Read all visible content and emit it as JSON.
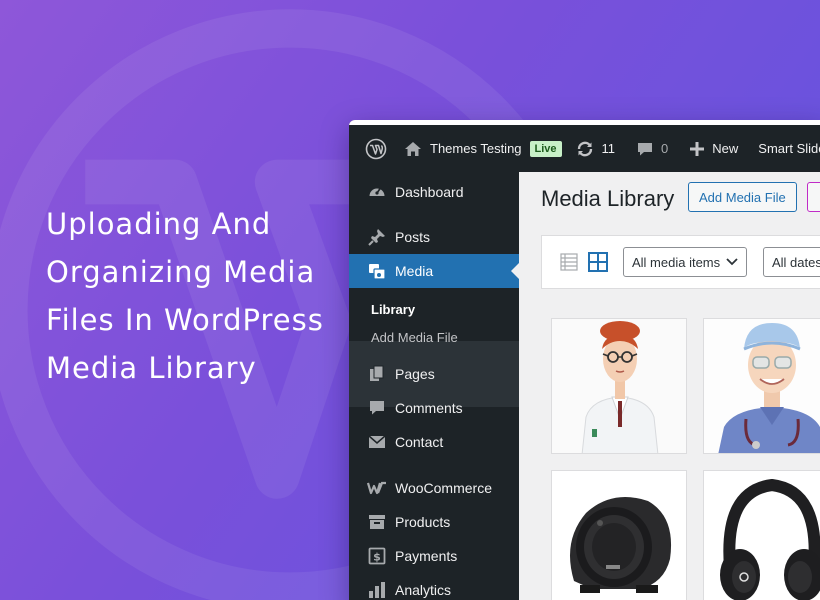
{
  "headline": {
    "lines": [
      "Uploading And",
      "Organizing Media",
      "Files In WordPress",
      "Media Library"
    ]
  },
  "colors": {
    "bg_from": "#8e57d9",
    "bg_to": "#5f55e0",
    "admin_dark": "#1d2327",
    "accent": "#2271b1",
    "live_badge": "#c8f0c8"
  },
  "adminbar": {
    "site_name": "Themes Testing",
    "live_label": "Live",
    "updates_count": "11",
    "comments_count": "0",
    "new_label": "New",
    "plugin_label": "Smart Slider",
    "icons": [
      "wordpress-logo-icon",
      "home-icon",
      "updates-icon",
      "comment-icon",
      "plus-icon"
    ]
  },
  "sidebar": {
    "items": [
      {
        "label": "Dashboard",
        "icon": "dashboard-icon"
      },
      {
        "label": "Posts",
        "icon": "pin-icon"
      },
      {
        "label": "Media",
        "icon": "media-icon",
        "active": true
      },
      {
        "label": "Pages",
        "icon": "pages-icon"
      },
      {
        "label": "Comments",
        "icon": "comment-icon"
      },
      {
        "label": "Contact",
        "icon": "envelope-icon"
      },
      {
        "label": "WooCommerce",
        "icon": "woocommerce-icon"
      },
      {
        "label": "Products",
        "icon": "archive-icon"
      },
      {
        "label": "Payments",
        "icon": "dollar-icon"
      },
      {
        "label": "Analytics",
        "icon": "bar-chart-icon"
      }
    ],
    "submenu": [
      {
        "label": "Library",
        "current": true
      },
      {
        "label": "Add Media File"
      }
    ]
  },
  "main": {
    "title": "Media Library",
    "add_button": "Add Media File",
    "filters": {
      "media_type": "All media items",
      "dates": "All dates"
    },
    "thumbnails": [
      "woman-in-lab-coat",
      "smiling-nurse-in-scrubs",
      "black-speaker",
      "black-headphones"
    ]
  }
}
